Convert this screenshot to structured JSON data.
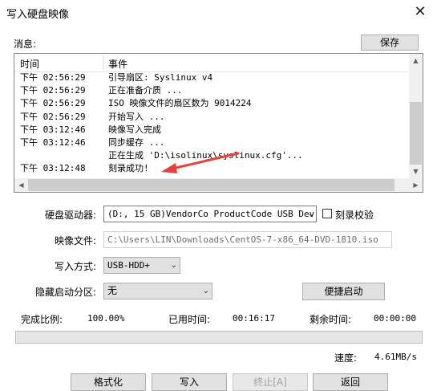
{
  "window": {
    "title": "写入硬盘映像",
    "close_glyph": "✕"
  },
  "messages": {
    "label": "消息:",
    "save_label": "保存",
    "columns": {
      "time": "时间",
      "event": "事件"
    },
    "rows": [
      {
        "time": "下午 02:56:29",
        "event": "引导扇区: Syslinux v4"
      },
      {
        "time": "下午 02:56:29",
        "event": "正在准备介质 ..."
      },
      {
        "time": "下午 02:56:29",
        "event": "ISO 映像文件的扇区数为 9014224"
      },
      {
        "time": "下午 02:56:29",
        "event": "开始写入 ..."
      },
      {
        "time": "下午 03:12:46",
        "event": "映像写入完成"
      },
      {
        "time": "下午 03:12:46",
        "event": "同步缓存 ..."
      },
      {
        "time": "",
        "event": "正在生成 'D:\\isolinux\\syslinux.cfg'..."
      },
      {
        "time": "下午 03:12:48",
        "event": "刻录成功!"
      }
    ]
  },
  "form": {
    "drive_label": "硬盘驱动器:",
    "drive_value": "(D:, 15 GB)VendorCo ProductCode USB Dev",
    "verify_label": "刻录校验",
    "image_label": "映像文件:",
    "image_value": "C:\\Users\\LIN\\Downloads\\CentOS-7-x86_64-DVD-1810.iso",
    "method_label": "写入方式:",
    "method_value": "USB-HDD+",
    "hidden_label": "隐藏启动分区:",
    "hidden_value": "无",
    "quickboot_label": "便捷启动"
  },
  "status": {
    "ratio_label": "完成比例:",
    "ratio_value": "100.00%",
    "elapsed_label": "已用时间:",
    "elapsed_value": "00:16:17",
    "remaining_label": "剩余时间:",
    "remaining_value": "00:00:00",
    "speed_label": "速度:",
    "speed_value": "4.61MB/s",
    "progress": 1.0
  },
  "buttons": {
    "format": "格式化",
    "write": "写入",
    "stop": "终止[A]",
    "back": "返回"
  },
  "icons": {
    "dropdown": "chevron-down-icon",
    "close": "close-icon"
  },
  "colors": {
    "arrow": "#e8413a",
    "window_bg": "#ffffff"
  }
}
